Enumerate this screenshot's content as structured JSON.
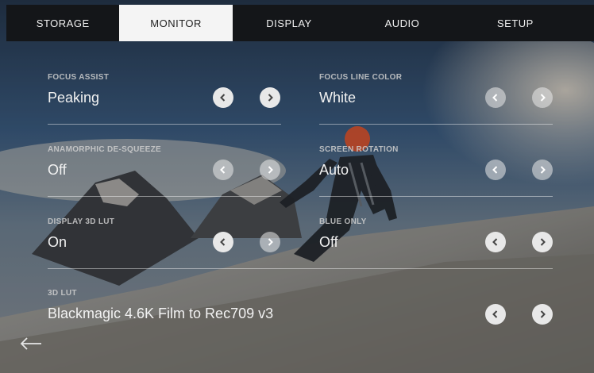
{
  "tabs": [
    {
      "label": "STORAGE"
    },
    {
      "label": "MONITOR"
    },
    {
      "label": "DISPLAY"
    },
    {
      "label": "AUDIO"
    },
    {
      "label": "SETUP"
    }
  ],
  "active_tab": "MONITOR",
  "settings": {
    "focus_assist": {
      "label": "FOCUS ASSIST",
      "value": "Peaking"
    },
    "focus_line_color": {
      "label": "FOCUS LINE COLOR",
      "value": "White"
    },
    "anamorphic": {
      "label": "ANAMORPHIC DE-SQUEEZE",
      "value": "Off"
    },
    "screen_rotation": {
      "label": "SCREEN ROTATION",
      "value": "Auto"
    },
    "display_3d_lut": {
      "label": "DISPLAY 3D LUT",
      "value": "On"
    },
    "blue_only": {
      "label": "BLUE ONLY",
      "value": "Off"
    },
    "lut_3d": {
      "label": "3D LUT",
      "value": "Blackmagic 4.6K Film to Rec709 v3"
    }
  },
  "icons": {
    "prev": "chevron-left-icon",
    "next": "chevron-right-icon",
    "back": "arrow-left-icon"
  },
  "colors": {
    "tab_bar": "#141619",
    "active_tab": "#f4f4f4",
    "text": "#f2f2f2",
    "button": "#e8e8e8"
  }
}
